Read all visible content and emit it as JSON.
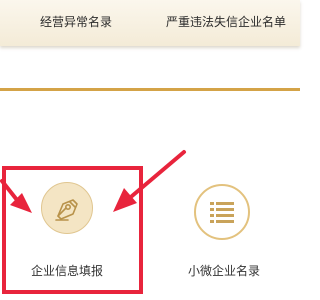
{
  "top_nav": {
    "left_link": "经营异常名录",
    "right_link": "严重违法失信企业名单"
  },
  "tiles": [
    {
      "label": "企业信息填报",
      "icon": "pen-nib-icon",
      "highlighted": true
    },
    {
      "label": "小微企业名录",
      "icon": "list-icon",
      "highlighted": false
    }
  ],
  "colors": {
    "gold_rule": "#d4a347",
    "highlight_red": "#e8243c",
    "icon_gold": "#c9a35a",
    "circle_fill": "#f4e5c4"
  }
}
